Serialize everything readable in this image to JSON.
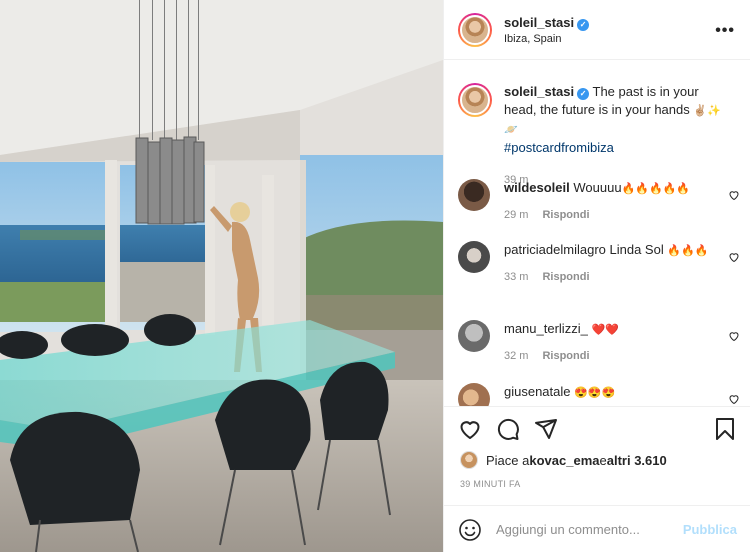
{
  "post": {
    "author": "soleil_stasi",
    "location": "Ibiza, Spain",
    "caption_text": "The past is in your head, the future is in your hands ",
    "caption_emojis": "✌🏼✨🪐",
    "hashtag": "#postcardfromibiza",
    "caption_time": "39 m"
  },
  "comments": [
    {
      "user": "wildesoleil",
      "text": "Wouuuu",
      "emojis": "🔥🔥🔥🔥🔥",
      "time": "29 m",
      "reply": "Rispondi"
    },
    {
      "user": "patriciadelmilagro",
      "text": "Linda Sol",
      "emojis": "🔥🔥🔥",
      "time": "33 m",
      "reply": "Rispondi"
    },
    {
      "user": "manu_terlizzi_",
      "text": "",
      "emojis": "❤️❤️",
      "time": "32 m",
      "reply": "Rispondi"
    },
    {
      "user": "giusenatale",
      "text": "",
      "emojis": "😍😍😍",
      "time": "",
      "reply": ""
    }
  ],
  "actions": {
    "likes_prefix": "Piace a ",
    "likes_user": "kovac_ema",
    "likes_middle": " e ",
    "likes_count": "altri 3.610",
    "timestamp": "39 MINUTI FA",
    "comment_placeholder": "Aggiungi un commento...",
    "publish_label": "Pubblica"
  },
  "icons": {
    "more": "more-options-icon",
    "like": "heart-icon",
    "comment": "comment-icon",
    "share": "share-icon",
    "save": "bookmark-icon",
    "emoji": "emoji-icon",
    "verified": "verified-badge-icon"
  },
  "colors": {
    "text": "#262626",
    "secondary": "#8e8e8e",
    "link": "#00376b",
    "verified": "#3897f0",
    "publish_disabled": "#b2dffc",
    "divider": "#efefef"
  }
}
